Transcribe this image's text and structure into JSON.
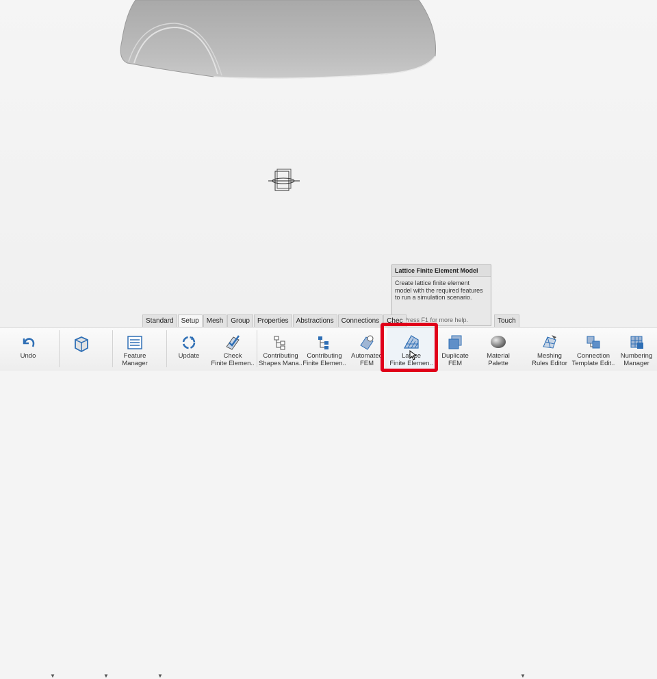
{
  "tooltip": {
    "title": "Lattice Finite Element Model",
    "description": "Create lattice finite element model with the required features to run a simulation scenario.",
    "help": "Press F1 for more help."
  },
  "tabs": [
    "Standard",
    "Setup",
    "Mesh",
    "Group",
    "Properties",
    "Abstractions",
    "Connections",
    "Chec"
  ],
  "tab_active": "Setup",
  "tab_touch": "Touch",
  "toolbar": {
    "undo": "Undo",
    "feature_manager": [
      "Feature",
      "Manager"
    ],
    "update": "Update",
    "check_fe": [
      "Check",
      "Finite Elemen.."
    ],
    "contrib_shapes": [
      "Contributing",
      "Shapes Mana.."
    ],
    "contrib_fe": [
      "Contributing",
      "Finite Elemen.."
    ],
    "automated_fem": [
      "Automated",
      "FEM"
    ],
    "lattice": [
      "Lattice",
      "Finite Elemen.."
    ],
    "duplicate_fem": [
      "Duplicate",
      "FEM"
    ],
    "material_palette": [
      "Material",
      "Palette"
    ],
    "meshing_rules": [
      "Meshing",
      "Rules Editor"
    ],
    "connection_template": [
      "Connection",
      "Template Edit.."
    ],
    "numbering_manager": [
      "Numbering",
      "Manager"
    ]
  },
  "colors": {
    "highlight": "#e0001a",
    "icon_blue": "#2f6fb5"
  }
}
